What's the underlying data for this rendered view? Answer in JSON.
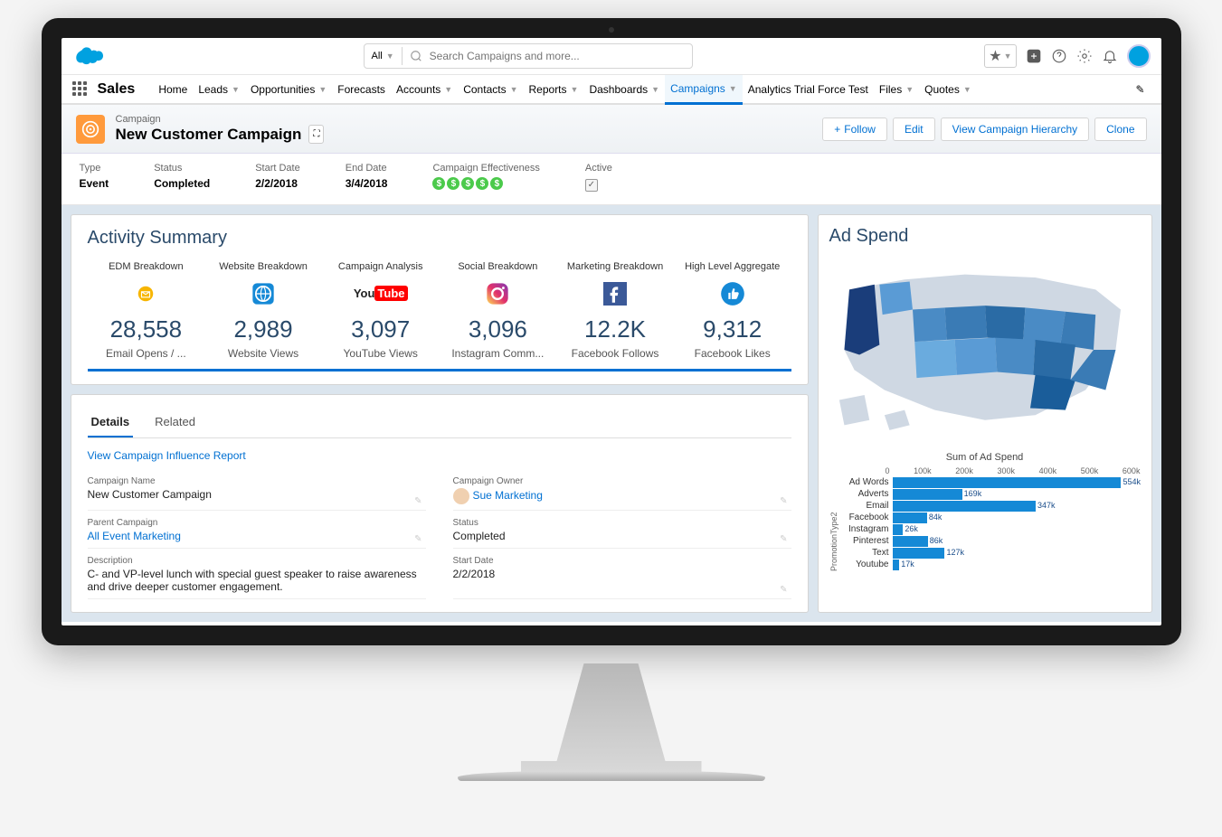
{
  "search": {
    "scope": "All",
    "placeholder": "Search Campaigns and more..."
  },
  "app": "Sales",
  "nav": [
    "Home",
    "Leads",
    "Opportunities",
    "Forecasts",
    "Accounts",
    "Contacts",
    "Reports",
    "Dashboards",
    "Campaigns",
    "Analytics Trial Force Test",
    "Files",
    "Quotes"
  ],
  "nav_active": "Campaigns",
  "record": {
    "object_label": "Campaign",
    "name": "New Customer Campaign",
    "actions": {
      "follow": "Follow",
      "edit": "Edit",
      "hierarchy": "View Campaign Hierarchy",
      "clone": "Clone"
    }
  },
  "meta": {
    "type": {
      "label": "Type",
      "value": "Event"
    },
    "status": {
      "label": "Status",
      "value": "Completed"
    },
    "start": {
      "label": "Start Date",
      "value": "2/2/2018"
    },
    "end": {
      "label": "End Date",
      "value": "3/4/2018"
    },
    "effectiveness": {
      "label": "Campaign Effectiveness",
      "count": 5
    },
    "active": {
      "label": "Active",
      "checked": true
    }
  },
  "activity": {
    "heading": "Activity Summary",
    "items": [
      {
        "title": "EDM Breakdown",
        "value": "28,558",
        "sub": "Email Opens / ...",
        "icon": "mail",
        "color": "#f7b500"
      },
      {
        "title": "Website Breakdown",
        "value": "2,989",
        "sub": "Website Views",
        "icon": "globe",
        "color": "#1589d6"
      },
      {
        "title": "Campaign Analysis",
        "value": "3,097",
        "sub": "YouTube Views",
        "icon": "youtube",
        "color": "#ff0000"
      },
      {
        "title": "Social Breakdown",
        "value": "3,096",
        "sub": "Instagram Comm...",
        "icon": "instagram",
        "color": "#e1306c"
      },
      {
        "title": "Marketing Breakdown",
        "value": "12.2K",
        "sub": "Facebook Follows",
        "icon": "facebook",
        "color": "#3b5998"
      },
      {
        "title": "High Level Aggregate",
        "value": "9,312",
        "sub": "Facebook Likes",
        "icon": "thumb",
        "color": "#1589d6"
      }
    ]
  },
  "tabs": {
    "details": "Details",
    "related": "Related",
    "active": "Details"
  },
  "details": {
    "link": "View Campaign Influence Report",
    "campaign_name": {
      "label": "Campaign Name",
      "value": "New Customer Campaign"
    },
    "owner": {
      "label": "Campaign Owner",
      "value": "Sue Marketing"
    },
    "parent": {
      "label": "Parent Campaign",
      "value": "All Event Marketing"
    },
    "status": {
      "label": "Status",
      "value": "Completed"
    },
    "description": {
      "label": "Description",
      "value": "C- and VP-level lunch with special guest speaker to raise awareness and drive deeper customer engagement."
    },
    "start": {
      "label": "Start Date",
      "value": "2/2/2018"
    }
  },
  "adspend": {
    "heading": "Ad Spend"
  },
  "chart_data": {
    "type": "bar",
    "title": "Sum of Ad Spend",
    "ylabel": "PromotionType2",
    "xlabel": "",
    "xlim": [
      0,
      600
    ],
    "ticks": [
      0,
      "100k",
      "200k",
      "300k",
      "400k",
      "500k",
      "600k"
    ],
    "categories": [
      "Ad Words",
      "Adverts",
      "Email",
      "Facebook",
      "Instagram",
      "Pinterest",
      "Text",
      "Youtube"
    ],
    "values": [
      554,
      169,
      347,
      84,
      26,
      86,
      127,
      17
    ],
    "value_labels": [
      "554k",
      "169k",
      "347k",
      "84k",
      "26k",
      "86k",
      "127k",
      "17k"
    ]
  }
}
